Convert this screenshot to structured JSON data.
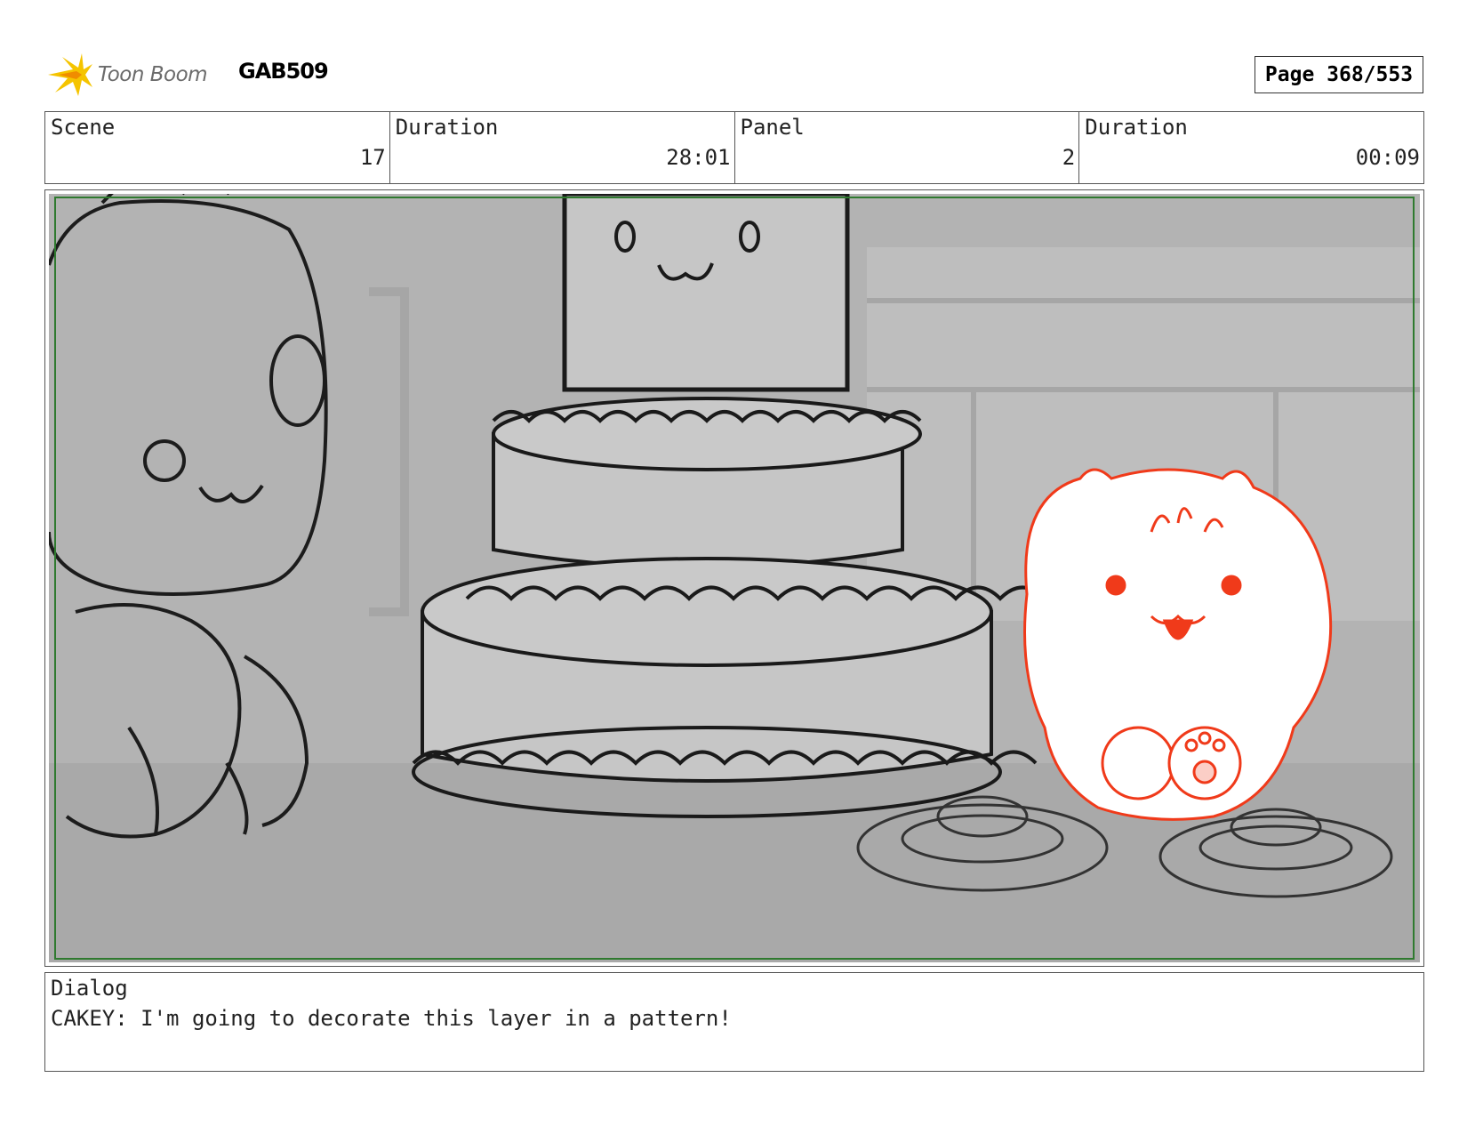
{
  "header": {
    "logo_text": "Toon Boom",
    "project_code": "GAB509",
    "page_label": "Page 368/553"
  },
  "info": {
    "scene_label": "Scene",
    "scene_value": "17",
    "scene_duration_label": "Duration",
    "scene_duration_value": "28:01",
    "panel_label": "Panel",
    "panel_value": "2",
    "panel_duration_label": "Duration",
    "panel_duration_value": "00:09"
  },
  "dialog": {
    "label": "Dialog",
    "text": "CAKEY: I'm going to decorate this layer in a pattern!"
  },
  "colors": {
    "safe_frame": "#2f7a2f",
    "character_sketch": "#f03a1a",
    "logo_flame": "#f5c400"
  }
}
